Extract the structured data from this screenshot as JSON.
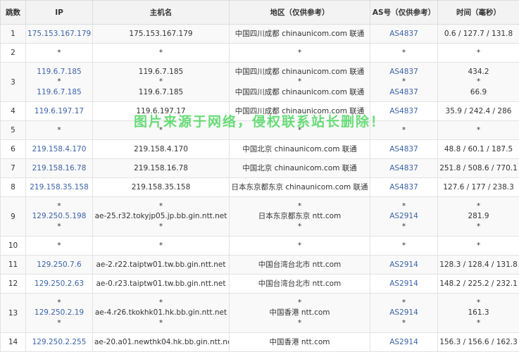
{
  "headers": [
    "跳数",
    "IP",
    "主机名",
    "地区（仅供参考）",
    "AS号（仅供参考）",
    "时间（毫秒）"
  ],
  "rows": [
    {
      "hop": "1",
      "ip": [
        "175.153.167.179"
      ],
      "host": [
        "175.153.167.179"
      ],
      "region": [
        "中国四川成都 chinaunicom.com 联通"
      ],
      "as": [
        "AS4837"
      ],
      "time": [
        "0.6 / 127.7 / 131.8"
      ]
    },
    {
      "hop": "2",
      "ip": [
        "*"
      ],
      "host": [
        "*"
      ],
      "region": [
        "*"
      ],
      "as": [
        "*"
      ],
      "time": [
        "*"
      ]
    },
    {
      "hop": "3",
      "ip": [
        "119.6.7.185",
        "*",
        "119.6.7.185"
      ],
      "host": [
        "119.6.7.185",
        "*",
        "119.6.7.185"
      ],
      "region": [
        "中国四川成都 chinaunicom.com 联通",
        "*",
        "中国四川成都 chinaunicom.com 联通"
      ],
      "as": [
        "AS4837",
        "*",
        "AS4837"
      ],
      "time": [
        "434.2",
        "*",
        "66.9"
      ]
    },
    {
      "hop": "4",
      "ip": [
        "119.6.197.17"
      ],
      "host": [
        "119.6.197.17"
      ],
      "region": [
        "中国四川成都 chinaunicom.com 联通"
      ],
      "as": [
        "AS4837"
      ],
      "time": [
        "35.9 / 242.4 / 286"
      ]
    },
    {
      "hop": "5",
      "ip": [
        "*"
      ],
      "host": [
        "*"
      ],
      "region": [
        "*"
      ],
      "as": [
        "*"
      ],
      "time": [
        "*"
      ]
    },
    {
      "hop": "6",
      "ip": [
        "219.158.4.170"
      ],
      "host": [
        "219.158.4.170"
      ],
      "region": [
        "中国北京 chinaunicom.com 联通"
      ],
      "as": [
        "AS4837"
      ],
      "time": [
        "48.8 / 60.1 / 187.5"
      ]
    },
    {
      "hop": "7",
      "ip": [
        "219.158.16.78"
      ],
      "host": [
        "219.158.16.78"
      ],
      "region": [
        "中国北京 chinaunicom.com 联通"
      ],
      "as": [
        "AS4837"
      ],
      "time": [
        "251.8 / 508.6 / 770.1"
      ]
    },
    {
      "hop": "8",
      "ip": [
        "219.158.35.158"
      ],
      "host": [
        "219.158.35.158"
      ],
      "region": [
        "日本东京都东京 chinaunicom.com 联通"
      ],
      "as": [
        "AS4837"
      ],
      "time": [
        "127.6 / 177 / 238.3"
      ]
    },
    {
      "hop": "9",
      "ip": [
        "*",
        "129.250.5.198",
        "*"
      ],
      "host": [
        "*",
        "ae-25.r32.tokyjp05.jp.bb.gin.ntt.net",
        "*"
      ],
      "region": [
        "*",
        "日本东京都东京 ntt.com",
        "*"
      ],
      "as": [
        "*",
        "AS2914",
        "*"
      ],
      "time": [
        "*",
        "281.9",
        "*"
      ]
    },
    {
      "hop": "10",
      "ip": [
        "*"
      ],
      "host": [
        "*"
      ],
      "region": [
        "*"
      ],
      "as": [
        "*"
      ],
      "time": [
        "*"
      ]
    },
    {
      "hop": "11",
      "ip": [
        "129.250.7.6"
      ],
      "host": [
        "ae-2.r22.taiptw01.tw.bb.gin.ntt.net"
      ],
      "region": [
        "中国台湾台北市 ntt.com"
      ],
      "as": [
        "AS2914"
      ],
      "time": [
        "128.3 / 128.4 / 131.8"
      ]
    },
    {
      "hop": "12",
      "ip": [
        "129.250.2.63"
      ],
      "host": [
        "ae-0.r23.taiptw01.tw.bb.gin.ntt.net"
      ],
      "region": [
        "中国台湾台北市 ntt.com"
      ],
      "as": [
        "AS2914"
      ],
      "time": [
        "148.2 / 225.2 / 232.1"
      ]
    },
    {
      "hop": "13",
      "ip": [
        "*",
        "129.250.2.19",
        "*"
      ],
      "host": [
        "*",
        "ae-4.r26.tkokhk01.hk.bb.gin.ntt.net",
        "*"
      ],
      "region": [
        "*",
        "中国香港 ntt.com",
        "*"
      ],
      "as": [
        "*",
        "AS2914",
        "*"
      ],
      "time": [
        "*",
        "161.3",
        "*"
      ]
    },
    {
      "hop": "14",
      "ip": [
        "129.250.2.255"
      ],
      "host": [
        "ae-20.a01.newthk04.hk.bb.gin.ntt.net"
      ],
      "region": [
        "中国香港 ntt.com"
      ],
      "as": [
        "AS2914"
      ],
      "time": [
        "156.3 / 156.6 / 162.3"
      ]
    }
  ],
  "watermark": "图片来源于网络，侵权联系站长删除！",
  "colors": {
    "link": "#3a63a8",
    "watermark": "#58d86a",
    "header_bg": "#f3f3f3",
    "zebra": "#f9f9f9"
  }
}
